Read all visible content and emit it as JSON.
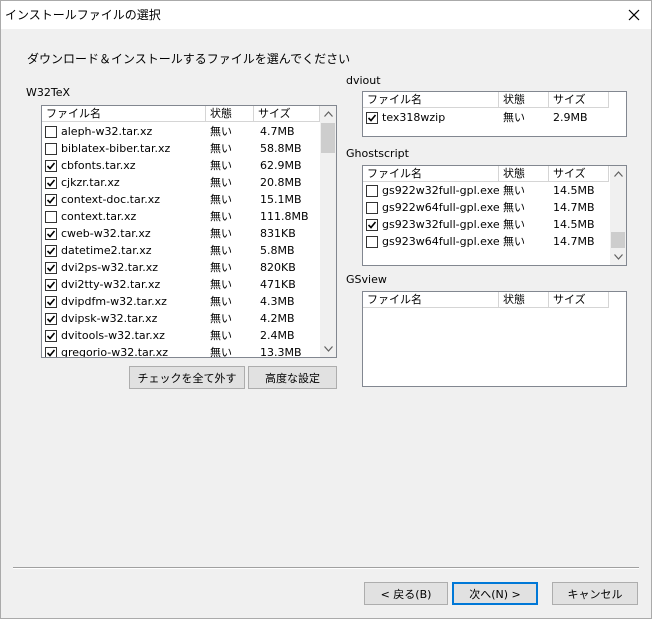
{
  "window": {
    "title": "インストールファイルの選択"
  },
  "instruction": "ダウンロード＆インストールするファイルを選んでください",
  "columns": {
    "name": "ファイル名",
    "status": "状態",
    "size": "サイズ"
  },
  "w32tex": {
    "label": "W32TeX",
    "rows": [
      {
        "checked": false,
        "name": "aleph-w32.tar.xz",
        "status": "無い",
        "size": "4.7MB"
      },
      {
        "checked": false,
        "name": "biblatex-biber.tar.xz",
        "status": "無い",
        "size": "58.8MB"
      },
      {
        "checked": true,
        "name": "cbfonts.tar.xz",
        "status": "無い",
        "size": "62.9MB"
      },
      {
        "checked": true,
        "name": "cjkzr.tar.xz",
        "status": "無い",
        "size": "20.8MB"
      },
      {
        "checked": true,
        "name": "context-doc.tar.xz",
        "status": "無い",
        "size": "15.1MB"
      },
      {
        "checked": false,
        "name": "context.tar.xz",
        "status": "無い",
        "size": "111.8MB"
      },
      {
        "checked": true,
        "name": "cweb-w32.tar.xz",
        "status": "無い",
        "size": "831KB"
      },
      {
        "checked": true,
        "name": "datetime2.tar.xz",
        "status": "無い",
        "size": "5.8MB"
      },
      {
        "checked": true,
        "name": "dvi2ps-w32.tar.xz",
        "status": "無い",
        "size": "820KB"
      },
      {
        "checked": true,
        "name": "dvi2tty-w32.tar.xz",
        "status": "無い",
        "size": "471KB"
      },
      {
        "checked": true,
        "name": "dvipdfm-w32.tar.xz",
        "status": "無い",
        "size": "4.3MB"
      },
      {
        "checked": true,
        "name": "dvipsk-w32.tar.xz",
        "status": "無い",
        "size": "4.2MB"
      },
      {
        "checked": true,
        "name": "dvitools-w32.tar.xz",
        "status": "無い",
        "size": "2.4MB"
      },
      {
        "checked": true,
        "name": "gregorio-w32.tar.xz",
        "status": "無い",
        "size": "13.3MB"
      }
    ]
  },
  "dviout": {
    "label": "dviout",
    "rows": [
      {
        "checked": true,
        "name": "tex318wzip",
        "status": "無い",
        "size": "2.9MB"
      }
    ]
  },
  "ghostscript": {
    "label": "Ghostscript",
    "rows": [
      {
        "checked": false,
        "name": "gs922w32full-gpl.exe",
        "status": "無い",
        "size": "14.5MB"
      },
      {
        "checked": false,
        "name": "gs922w64full-gpl.exe",
        "status": "無い",
        "size": "14.7MB"
      },
      {
        "checked": true,
        "name": "gs923w32full-gpl.exe",
        "status": "無い",
        "size": "14.5MB"
      },
      {
        "checked": false,
        "name": "gs923w64full-gpl.exe",
        "status": "無い",
        "size": "14.7MB"
      }
    ]
  },
  "gsview": {
    "label": "GSview",
    "rows": []
  },
  "buttons": {
    "uncheck_all": "チェックを全て外す",
    "advanced": "高度な設定",
    "back": "< 戻る(B)",
    "next": "次へ(N) >",
    "cancel": "キャンセル"
  },
  "colors": {
    "accent": "#0078d7",
    "window_bg": "#f0f0f0"
  }
}
